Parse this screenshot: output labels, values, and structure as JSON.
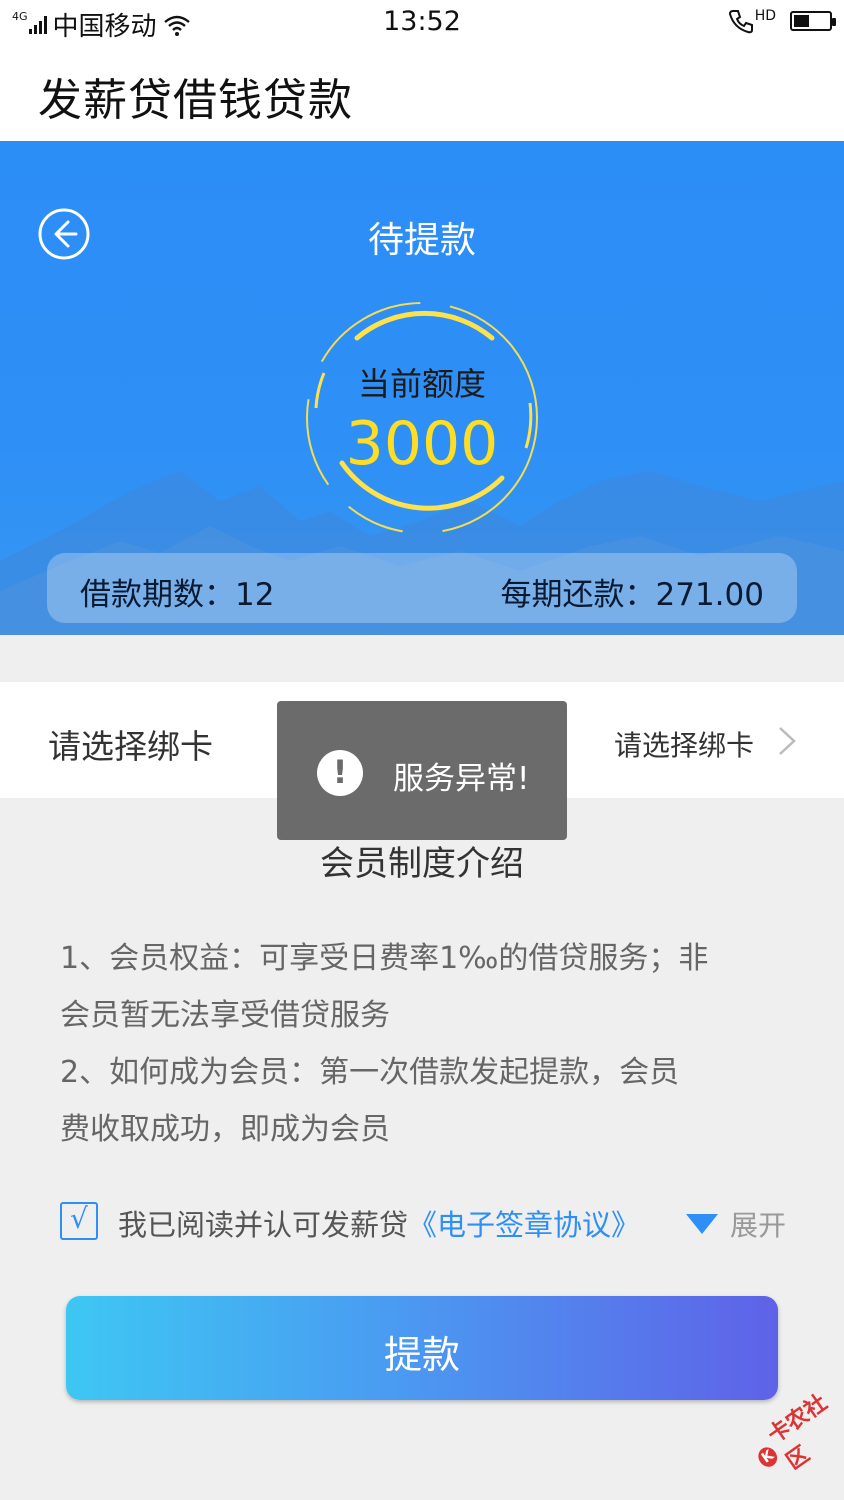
{
  "status_bar": {
    "network": "4G",
    "carrier": "中国移动",
    "time": "13:52",
    "hd": "HD",
    "battery_level": 0.45,
    "icons": [
      "signal-icon",
      "wifi-icon",
      "phone-hd-icon",
      "battery-icon"
    ]
  },
  "app_bar": {
    "title": "发薪贷借钱贷款"
  },
  "hero": {
    "title": "待提款",
    "quota_label": "当前额度",
    "quota_value": "3000",
    "term_label": "借款期数：12",
    "installment_label": "每期还款：271.00"
  },
  "card_select": {
    "label": "请选择绑卡",
    "value": "请选择绑卡"
  },
  "toast": {
    "text": "服务异常!",
    "icon": "!"
  },
  "member_intro": {
    "title": "会员制度介绍",
    "lines": [
      "1、会员权益：可享受日费率1‰的借贷服务；非",
      "会员暂无法享受借贷服务",
      "2、如何成为会员：第一次借款发起提款，会员",
      "费收取成功，即成为会员"
    ]
  },
  "agreement": {
    "checked_mark": "√",
    "text": "我已阅读并认可发薪贷",
    "link": "《电子签章协议》",
    "expand": "展开"
  },
  "withdraw_button": {
    "label": "提款"
  },
  "watermark": {
    "text": "卡农社区",
    "logo": "K"
  },
  "colors": {
    "primary": "#2e8ff6",
    "quota_yellow": "#ffdd22",
    "toast_bg": "#6b6b6b",
    "page_bg": "#efefef"
  }
}
